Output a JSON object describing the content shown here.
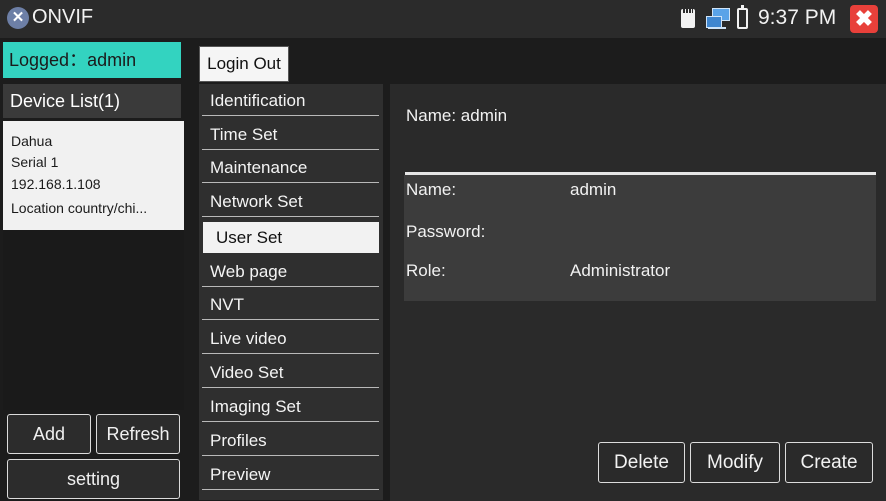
{
  "titlebar": {
    "app_icon": "onvif-logo-icon",
    "title": "ONVIF",
    "status_icons": [
      "sd-card-icon",
      "network-icon",
      "battery-icon"
    ],
    "time": "9:37 PM",
    "close_icon": "close-icon"
  },
  "session": {
    "logged_text": "Logged：admin",
    "login_out_label": "Login Out"
  },
  "device_list": {
    "header": "Device List(1)",
    "devices": [
      {
        "name": "Dahua",
        "serial": "Serial 1",
        "ip": "192.168.1.108",
        "location": "Location country/chi..."
      }
    ],
    "add_label": "Add",
    "refresh_label": "Refresh",
    "setting_label": "setting"
  },
  "menu": {
    "items": [
      {
        "label": "Identification"
      },
      {
        "label": "Time Set"
      },
      {
        "label": "Maintenance"
      },
      {
        "label": "Network Set"
      },
      {
        "label": "User Set"
      },
      {
        "label": "Web page"
      },
      {
        "label": "NVT"
      },
      {
        "label": "Live video"
      },
      {
        "label": "Video Set"
      },
      {
        "label": "Imaging Set"
      },
      {
        "label": "Profiles"
      },
      {
        "label": "Preview"
      }
    ],
    "active": "User Set"
  },
  "user_panel": {
    "header": "Name: admin",
    "fields": [
      {
        "label": "Name:",
        "value": "admin"
      },
      {
        "label": "Password:",
        "value": ""
      },
      {
        "label": "Role:",
        "value": "Administrator"
      }
    ],
    "delete_label": "Delete",
    "modify_label": "Modify",
    "create_label": "Create"
  },
  "colors": {
    "accent": "#33d3c0",
    "close": "#e8403a",
    "background": "#1c1c1c"
  }
}
